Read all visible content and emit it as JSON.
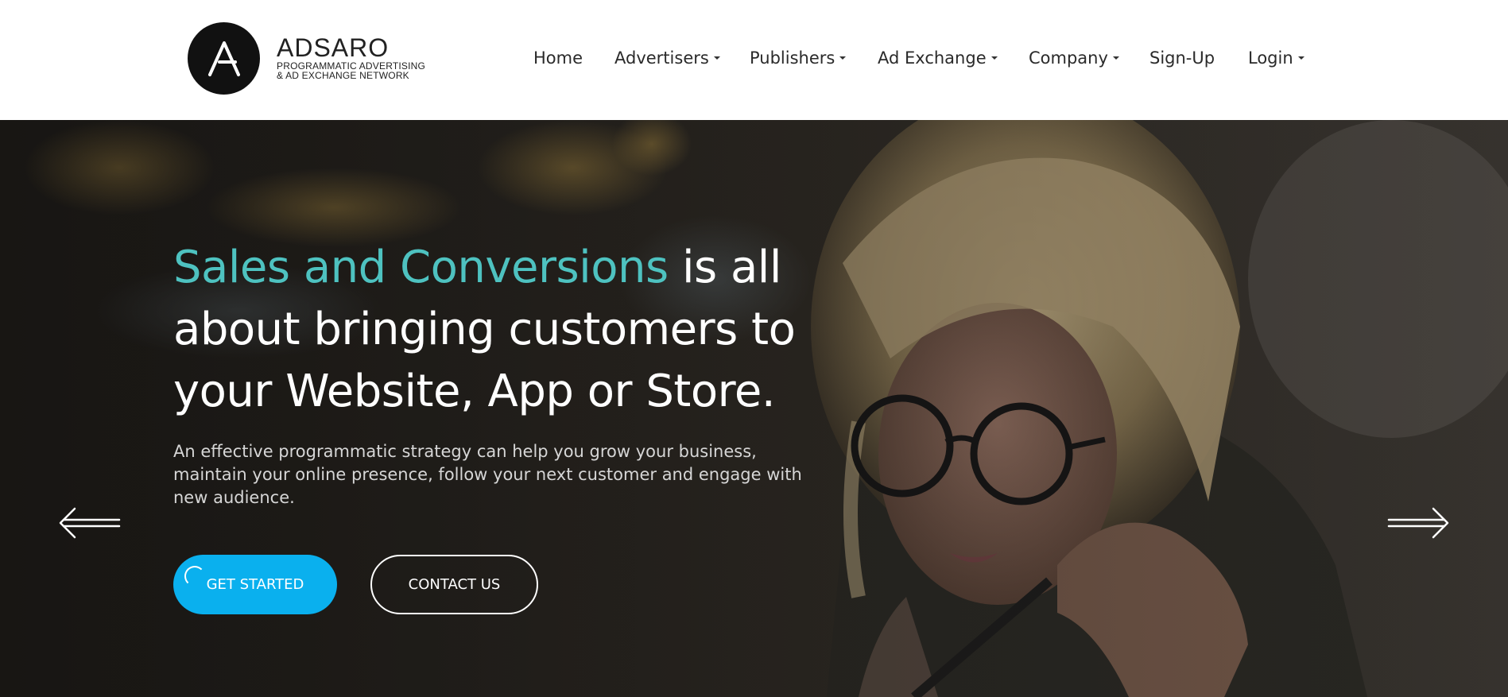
{
  "brand": {
    "name": "ADSARO",
    "tagline_line1": "PROGRAMMATIC ADVERTISING",
    "tagline_line2": "& AD EXCHANGE NETWORK",
    "logo_icon": "a-letter-logo-icon"
  },
  "nav": {
    "items": [
      {
        "label": "Home",
        "dropdown": false
      },
      {
        "label": "Advertisers",
        "dropdown": true
      },
      {
        "label": "Publishers",
        "dropdown": true
      },
      {
        "label": "Ad Exchange",
        "dropdown": true
      },
      {
        "label": "Company",
        "dropdown": true
      },
      {
        "label": "Sign-Up",
        "dropdown": false
      },
      {
        "label": "Login",
        "dropdown": true
      }
    ]
  },
  "hero": {
    "headline_accent": "Sales and Conversions",
    "headline_rest_1": " is all",
    "headline_line2": "about bringing customers to",
    "headline_line3": "your Website, App or Store.",
    "subtext": "An effective programmatic strategy can help you grow your business, maintain your online presence, follow your next customer and engage with new audience.",
    "primary_button": "GET STARTED",
    "secondary_button": "CONTACT US",
    "prev_icon": "arrow-left-icon",
    "next_icon": "arrow-right-icon"
  },
  "colors": {
    "accent_teal": "#4ec2c0",
    "primary_blue": "#0ab0ee",
    "header_bg": "#ffffff",
    "hero_dark": "#2c2a27"
  }
}
